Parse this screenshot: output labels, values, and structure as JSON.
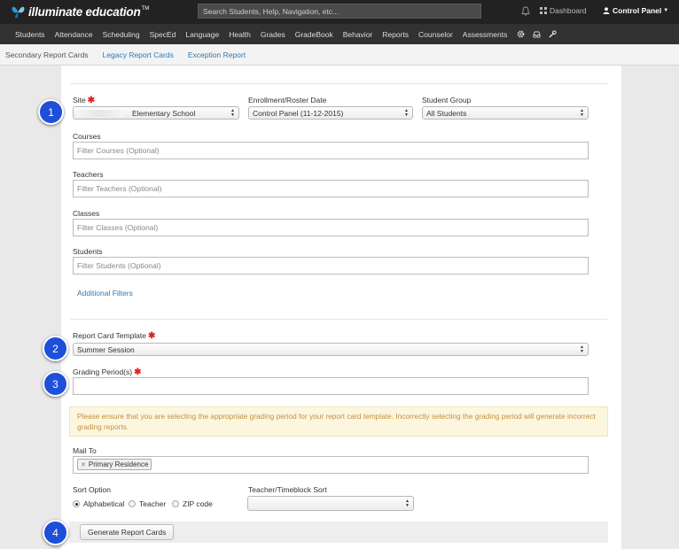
{
  "app": {
    "brand": "illuminate education",
    "trademark": "TM"
  },
  "search": {
    "placeholder": "Search Students, Help, Navigation, etc..."
  },
  "header": {
    "dashboard": "Dashboard",
    "user": "Control Panel"
  },
  "nav": {
    "items": [
      "Students",
      "Attendance",
      "Scheduling",
      "SpecEd",
      "Language",
      "Health",
      "Grades",
      "GradeBook",
      "Behavior",
      "Reports",
      "Counselor",
      "Assessments"
    ]
  },
  "subnav": {
    "items": [
      "Secondary Report Cards",
      "Legacy Report Cards",
      "Exception Report"
    ]
  },
  "form": {
    "site_label": "Site",
    "site_value": "Elementary School",
    "enrollment_label": "Enrollment/Roster Date",
    "enrollment_value": "Control Panel (11-12-2015)",
    "group_label": "Student Group",
    "group_value": "All Students",
    "courses_label": "Courses",
    "courses_placeholder": "Filter Courses (Optional)",
    "teachers_label": "Teachers",
    "teachers_placeholder": "Filter Teachers (Optional)",
    "classes_label": "Classes",
    "classes_placeholder": "Filter Classes (Optional)",
    "students_label": "Students",
    "students_placeholder": "Filter Students (Optional)",
    "additional_filters": "Additional Filters",
    "template_label": "Report Card Template",
    "template_value": "Summer Session",
    "grading_label": "Grading Period(s)",
    "alert_text": "Please ensure that you are selecting the appropriate grading period for your report card template. Incorrectly selecting the grading period will generate incorrect grading reports.",
    "mailto_label": "Mail To",
    "mailto_tag": "Primary Residence",
    "sort_label": "Sort Option",
    "sort_options": [
      "Alphabetical",
      "Teacher",
      "ZIP code"
    ],
    "timeblock_label": "Teacher/Timeblock Sort",
    "generate_button": "Generate Report Cards",
    "required_mark": "✱"
  },
  "markers": [
    "1",
    "2",
    "3",
    "4"
  ],
  "colors": {
    "marker": "#1f4fd8",
    "link": "#2a7ab9",
    "required": "#e0201c",
    "alert_text": "#c29140"
  }
}
